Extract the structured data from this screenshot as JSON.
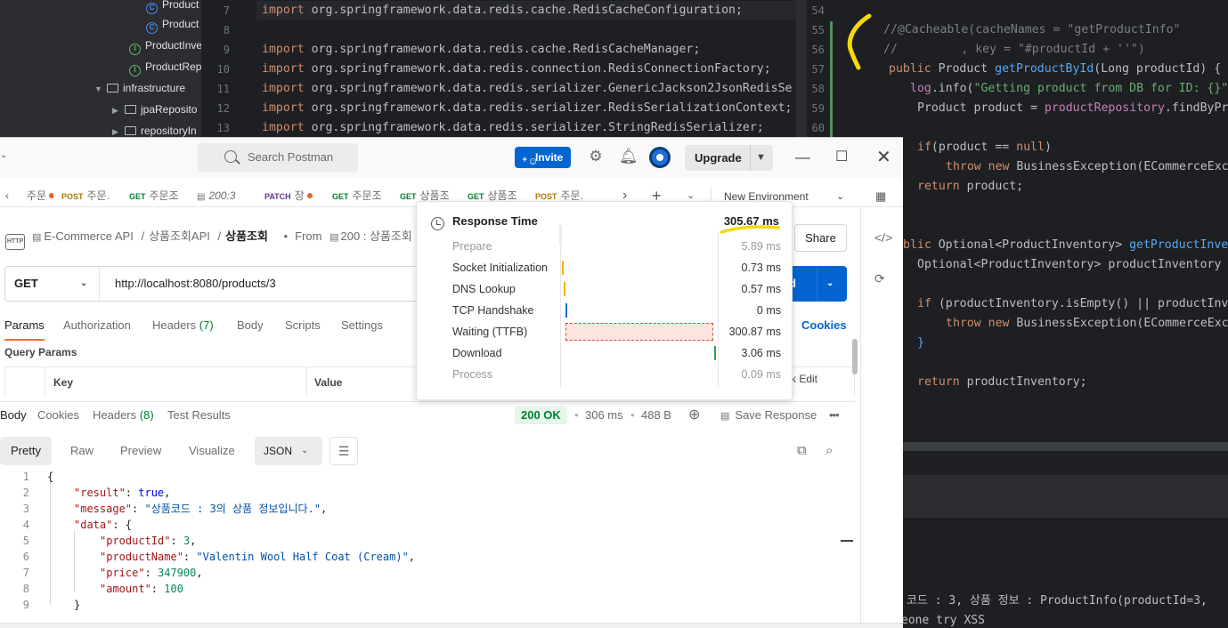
{
  "ide": {
    "tree": [
      {
        "label": "Product",
        "icon": "class-icon"
      },
      {
        "label": "Product",
        "icon": "class-icon"
      },
      {
        "label": "ProductInve",
        "icon": "interface-icon"
      },
      {
        "label": "ProductRep",
        "icon": "interface-icon"
      },
      {
        "label": "infrastructure",
        "icon": "folder-icon"
      },
      {
        "label": "jpaReposito",
        "icon": "folder-icon"
      },
      {
        "label": "repositoryIn",
        "icon": "folder-icon"
      }
    ],
    "left_lines": [
      "7",
      "8",
      "9",
      "10",
      "11",
      "12",
      "13"
    ],
    "left_code": [
      "org.springframework.data.redis.cache.RedisCacheConfiguration;",
      "",
      "org.springframework.data.redis.cache.RedisCacheManager;",
      "org.springframework.data.redis.connection.RedisConnectionFactory;",
      "org.springframework.data.redis.serializer.GenericJackson2JsonRedisSe",
      "org.springframework.data.redis.serializer.RedisSerializationContext;",
      "org.springframework.data.redis.serializer.StringRedisSerializer;"
    ],
    "import_kw": "import",
    "right_lines": [
      "54",
      "55",
      "56",
      "57",
      "58",
      "59",
      "60"
    ],
    "right_code": {
      "l55": "//@Cacheable(cacheNames = \"getProductInfo\"",
      "l56": "//         , key = \"#productId + ''\")",
      "l57_kw": "public",
      "l57_type": "Product",
      "l57_fn": "getProductById",
      "l57_rest": "(Long productId) {",
      "l58_fld": "log",
      "l58_a": ".info(",
      "l58_str": "\"Getting product from DB for ID: {}\"",
      "l59_a": "Product product = ",
      "l59_fld": "productRepository",
      "l59_b": ".findByPr",
      "l61_kw": "if",
      "l61_a": "(product == ",
      "l61_null": "null",
      "l61_b": ")",
      "l62_kw": "throw new",
      "l62_a": " BusinessException(ECommerceExc",
      "l63_kw": "return",
      "l63_a": " product;",
      "l66_kw": "blic",
      "l66_a": " Optional<ProductInventory> ",
      "l66_fn": "getProductInve",
      "l67_a": "Optional<ProductInventory> productInventory",
      "l69_kw": "if",
      "l69_a": " (productInventory.isEmpty() || productInv",
      "l70_kw": "throw new",
      "l70_a": " BusinessException(ECommerceExc",
      "l71": "}",
      "l73_kw": "return",
      "l73_a": " productInventory;"
    },
    "console": [
      "코드 : 3, 상품 정보 : ProductInfo(productId=3,",
      "eone try XSS"
    ]
  },
  "postman": {
    "search_placeholder": "Search Postman",
    "invite_label": "Invite",
    "upgrade_label": "Upgrade",
    "tabs": [
      {
        "method": "",
        "label": "주문",
        "dot": true
      },
      {
        "method": "POST",
        "label": "주문.",
        "dot": false
      },
      {
        "method": "GET",
        "label": "주문조",
        "dot": false
      },
      {
        "method": "",
        "label": "200:3",
        "dot": false
      },
      {
        "method": "PATCH",
        "label": "장",
        "dot": true
      },
      {
        "method": "GET",
        "label": "주문조",
        "dot": false
      },
      {
        "method": "GET",
        "label": "상품조",
        "dot": false
      },
      {
        "method": "GET",
        "label": "상품조",
        "dot": false
      },
      {
        "method": "POST",
        "label": "주문.",
        "dot": false
      }
    ],
    "environment": "New Environment",
    "breadcrumb": {
      "collection": "E-Commerce API",
      "folder": "상품조회API",
      "current": "상품조회",
      "from_label": "From",
      "from_value": "200 : 상품조회"
    },
    "share_label": "Share",
    "request": {
      "method": "GET",
      "url": "http://localhost:8080/products/3",
      "send_label": "nd"
    },
    "req_tabs": [
      "Params",
      "Authorization",
      "Headers",
      "Body",
      "Scripts",
      "Settings"
    ],
    "headers_count": "(7)",
    "cookies_label": "Cookies",
    "query_params_label": "Query Params",
    "kv_key": "Key",
    "kv_value": "Value",
    "bulk_edit": "k Edit",
    "res_tabs": [
      "Body",
      "Cookies",
      "Headers",
      "Test Results"
    ],
    "res_headers_count": "(8)",
    "status": "200 OK",
    "time": "306 ms",
    "size": "488 B",
    "save_response": "Save Response",
    "view_tabs": [
      "Pretty",
      "Raw",
      "Preview",
      "Visualize"
    ],
    "format": "JSON",
    "json_lines": [
      "1",
      "2",
      "3",
      "4",
      "5",
      "6",
      "7",
      "8",
      "9"
    ],
    "json": {
      "result_key": "\"result\"",
      "result_val": "true",
      "message_key": "\"message\"",
      "message_val": "\"상품코드 : 3의 상품 정보입니다.\"",
      "data_key": "\"data\"",
      "productId_key": "\"productId\"",
      "productId_val": "3",
      "productName_key": "\"productName\"",
      "productName_val": "\"Valentin Wool Half Coat (Cream)\"",
      "price_key": "\"price\"",
      "price_val": "347900",
      "amount_key": "\"amount\"",
      "amount_val": "100"
    },
    "response_time": {
      "title": "Response Time",
      "total": "305.67 ms",
      "phases": [
        {
          "label": "Prepare",
          "value": "5.89 ms",
          "ms": 5.89
        },
        {
          "label": "Socket Initialization",
          "value": "0.73 ms",
          "ms": 0.73
        },
        {
          "label": "DNS Lookup",
          "value": "0.57 ms",
          "ms": 0.57
        },
        {
          "label": "TCP Handshake",
          "value": "0 ms",
          "ms": 0
        },
        {
          "label": "Waiting (TTFB)",
          "value": "300.87 ms",
          "ms": 300.87
        },
        {
          "label": "Download",
          "value": "3.06 ms",
          "ms": 3.06
        },
        {
          "label": "Process",
          "value": "0.09 ms",
          "ms": 0.09
        }
      ]
    }
  },
  "colors": {
    "accent": "#0265d2",
    "postman_orange": "#ff6c37",
    "ok_green": "#007f31",
    "annotation_yellow": "#f5d90a"
  }
}
